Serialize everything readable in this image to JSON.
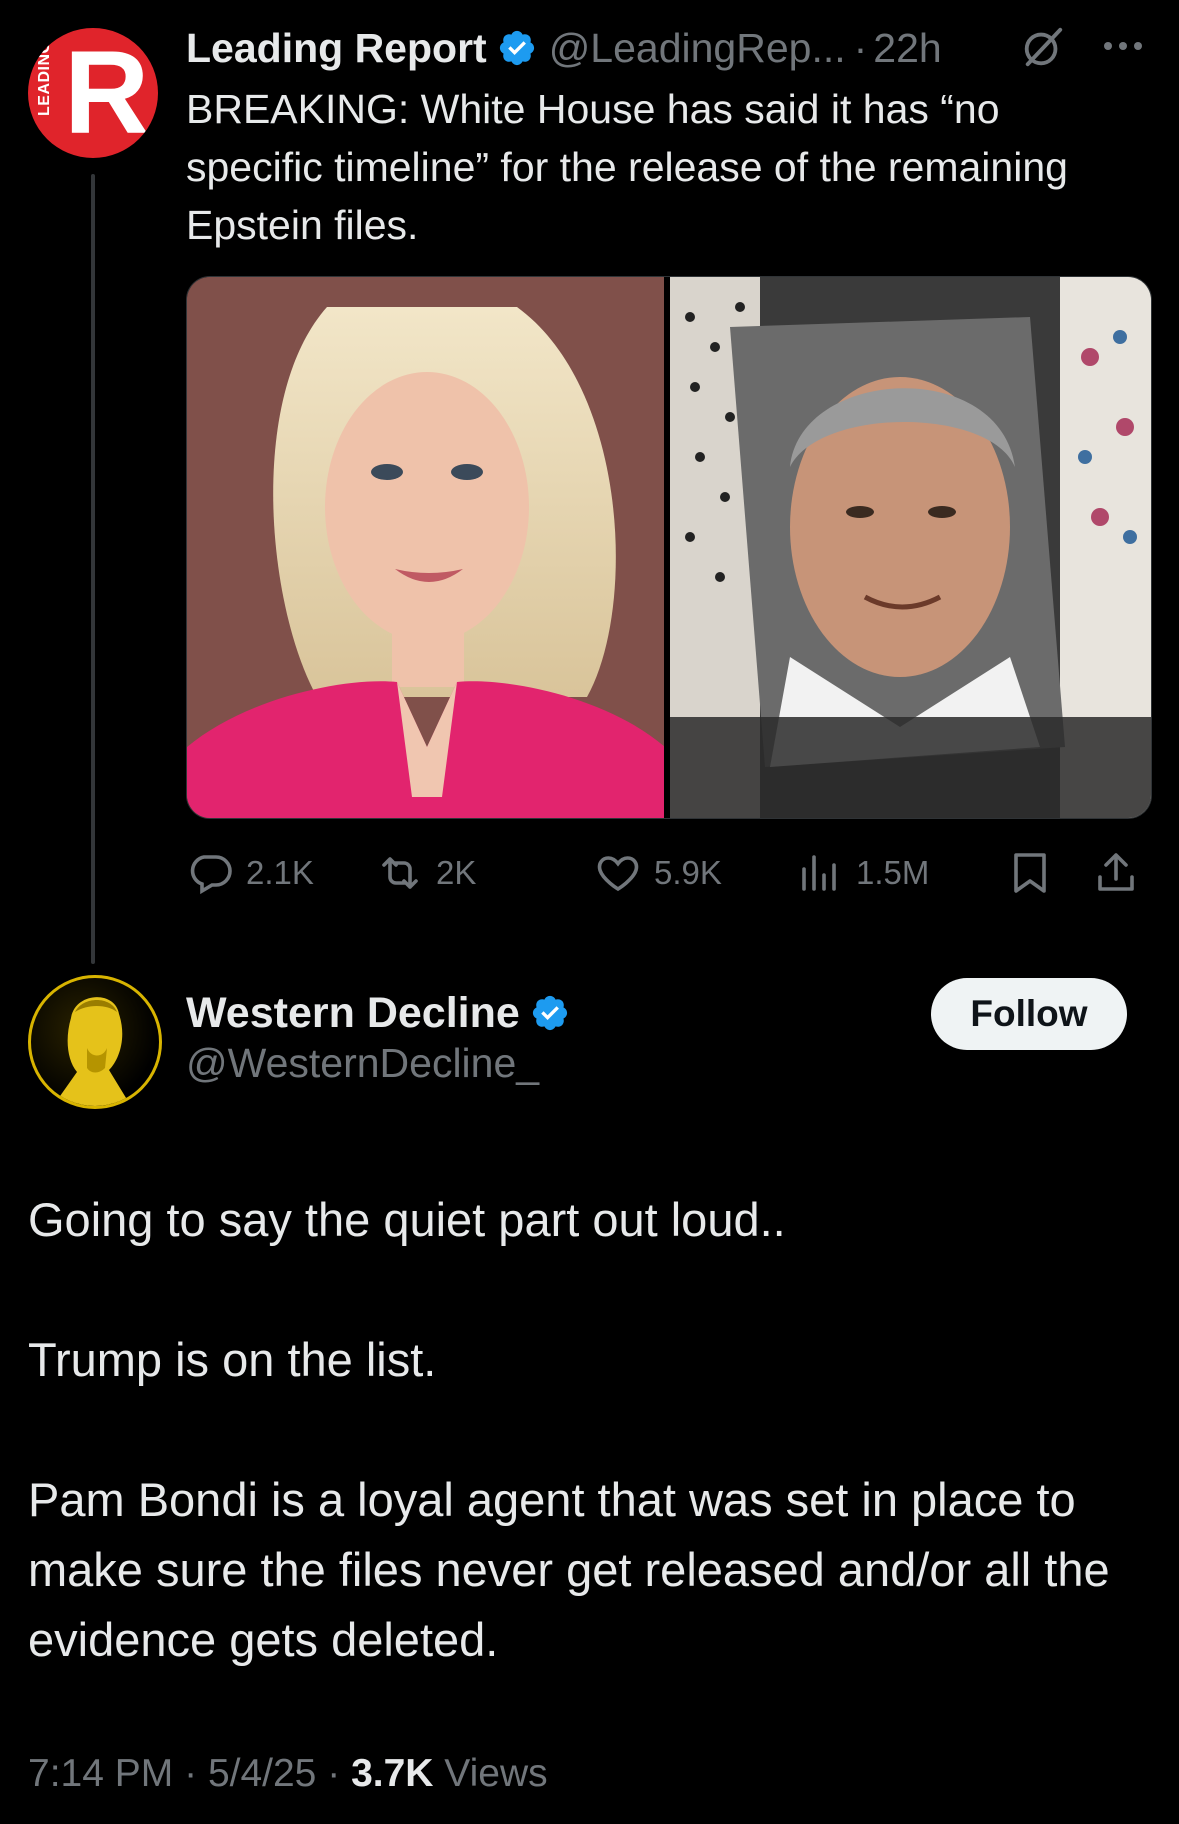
{
  "parent_tweet": {
    "avatar_letter": "R",
    "avatar_side_word": "LEADING",
    "name": "Leading Report",
    "handle": "@LeadingRep...",
    "separator": "·",
    "time": "22h",
    "text": "BREAKING: White House has said it has “no specific timeline” for the release of the remaining Epstein files.",
    "stats": {
      "replies": "2.1K",
      "reposts": "2K",
      "likes": "5.9K",
      "views": "1.5M"
    },
    "icons": [
      "verified-badge-icon",
      "grok-icon",
      "more-icon",
      "reply-icon",
      "repost-icon",
      "like-icon",
      "views-icon",
      "bookmark-icon",
      "share-icon"
    ]
  },
  "main_tweet": {
    "name": "Western Decline",
    "handle": "@WesternDecline_",
    "follow_label": "Follow",
    "paragraphs": [
      "Going to say the quiet part out loud..",
      "Trump is on the list.",
      "Pam Bondi is a loyal agent that was set in place to make sure the files never get released and/or all the evidence gets deleted."
    ],
    "meta": {
      "time": "7:14 PM",
      "sep1": "·",
      "date": "5/4/25",
      "sep2": "·",
      "views_count": "3.7K",
      "views_label": "Views"
    }
  },
  "colors": {
    "background": "#000000",
    "text_primary": "#e7e9ea",
    "text_secondary": "#71767b",
    "verified_blue": "#1d9bf0",
    "avatar_red": "#e0242b",
    "avatar_gold": "#d8b400"
  }
}
